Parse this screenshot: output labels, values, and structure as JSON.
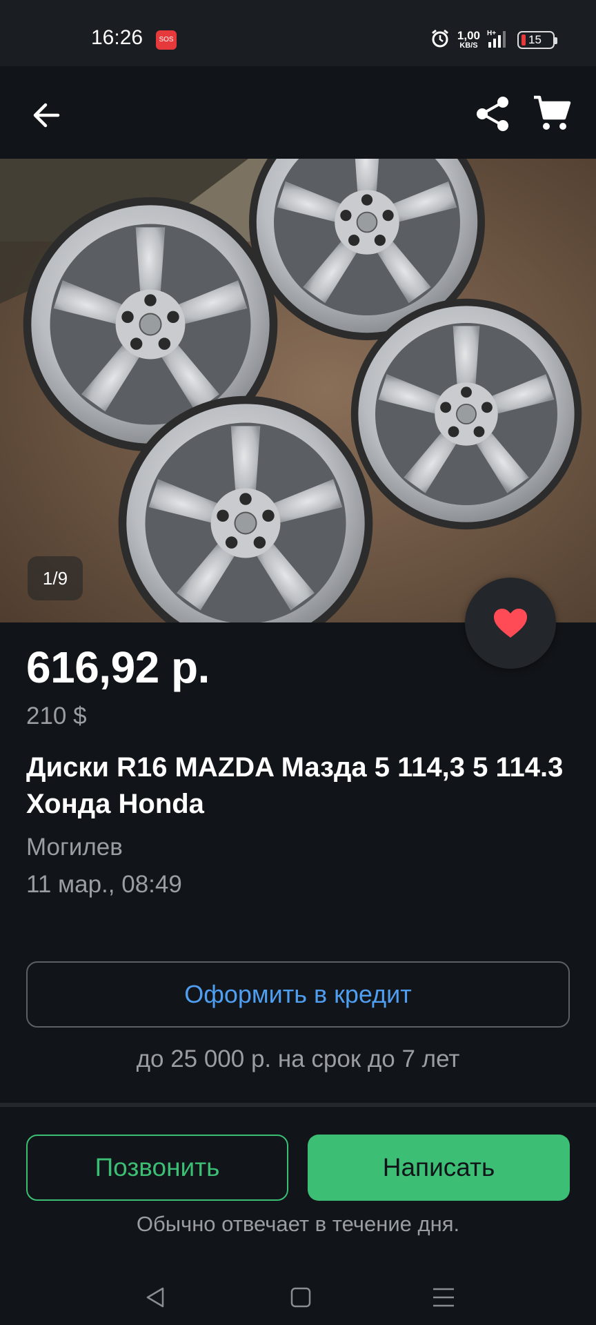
{
  "status_bar": {
    "time": "16:26",
    "sos": "SOS",
    "net_speed": "1,00",
    "net_unit": "KB/S",
    "battery": "15"
  },
  "app_bar": {
    "back_icon": "arrow-left-icon",
    "share_icon": "share-icon",
    "cart_icon": "cart-icon"
  },
  "gallery": {
    "counter": "1/9"
  },
  "listing": {
    "price": "616,92 р.",
    "price_usd": "210 $",
    "title": "Диски R16 MAZDA Мазда 5 114,3 5 114.3 Хонда Honda",
    "city": "Могилев",
    "date": "11 мар., 08:49"
  },
  "credit": {
    "button_label": "Оформить в кредит",
    "note": "до 25 000 р. на срок до 7 лет"
  },
  "actions": {
    "call_label": "Позвонить",
    "write_label": "Написать",
    "reply_note": "Обычно отвечает в течение дня."
  },
  "colors": {
    "background": "#111418",
    "accent_green": "#3cbf75",
    "link_blue": "#4f9ef0",
    "favorite_red": "#ff4b55"
  }
}
